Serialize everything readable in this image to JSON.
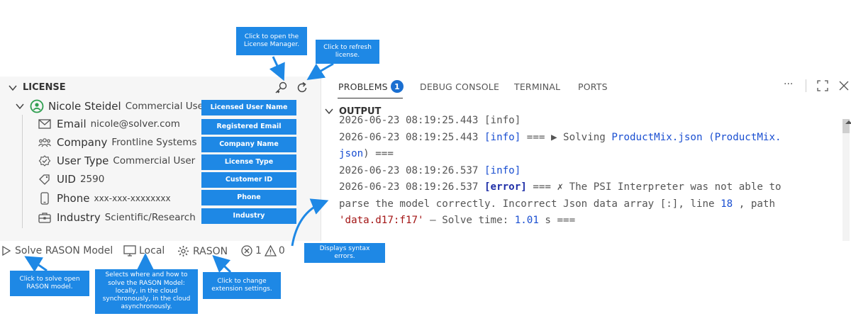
{
  "license": {
    "header": "LICENSE",
    "user": {
      "name": "Nicole Steidel",
      "type": "Commercial User"
    },
    "rows": [
      {
        "label": "Email",
        "value": "nicole@solver.com"
      },
      {
        "label": "Company",
        "value": "Frontline Systems"
      },
      {
        "label": "User Type",
        "value": "Commercial User"
      },
      {
        "label": "UID",
        "value": "2590"
      },
      {
        "label": "Phone",
        "value": "xxx-xxx-xxxxxxxx"
      },
      {
        "label": "Industry",
        "value": "Scientific/Research"
      }
    ],
    "field_callouts": [
      "Licensed User Name",
      "Registered Email",
      "Company Name",
      "License Type",
      "Customer ID",
      "Phone",
      "Industry"
    ]
  },
  "callouts": {
    "license_manager": "Click to open the License Manager.",
    "refresh": "Click to refresh license.",
    "solve": "Click to solve open RASON model.",
    "local": "Selects where and how to solve the RASON Model:  locally, in the cloud synchronously, in the cloud asynchronously.",
    "settings": "Click to change extension settings.",
    "syntax": "Displays syntax errors."
  },
  "panel": {
    "tabs": [
      "PROBLEMS",
      "DEBUG CONSOLE",
      "TERMINAL",
      "PORTS"
    ],
    "problems_count": "1",
    "more": "···",
    "output_header": "OUTPUT"
  },
  "log": {
    "l0": "2026-06-23 08:19:25.443 [info]",
    "l1_ts": "2026-06-23 08:19:25.443",
    "l1_tag": "[info]",
    "l1_pre": " === ▶ Solving ",
    "l1_link": "ProductMix.json",
    "l1_paren": "(ProductMix.",
    "l2_link": "json",
    "l2_post": ") ===",
    "l3_ts": "2026-06-23 08:19:26.537",
    "l3_tag": "[info]",
    "l4_ts": "2026-06-23 08:19:26.537",
    "l4_tag": "[error]",
    "l4_post": " === ✗ The PSI Interpreter was not able to",
    "l5_pre": "parse the model correctly. Incorrect Json data array [:], line ",
    "l5_num": "18",
    "l5_post": " , path",
    "l6_str": "'data.d17:f17'",
    "l6_mid": " – Solve time: ",
    "l6_num": "1.01",
    "l6_post": " s ==="
  },
  "status": {
    "solve": "Solve RASON Model",
    "location": "Local",
    "settings": "RASON",
    "errors": "1",
    "warnings": "0"
  }
}
